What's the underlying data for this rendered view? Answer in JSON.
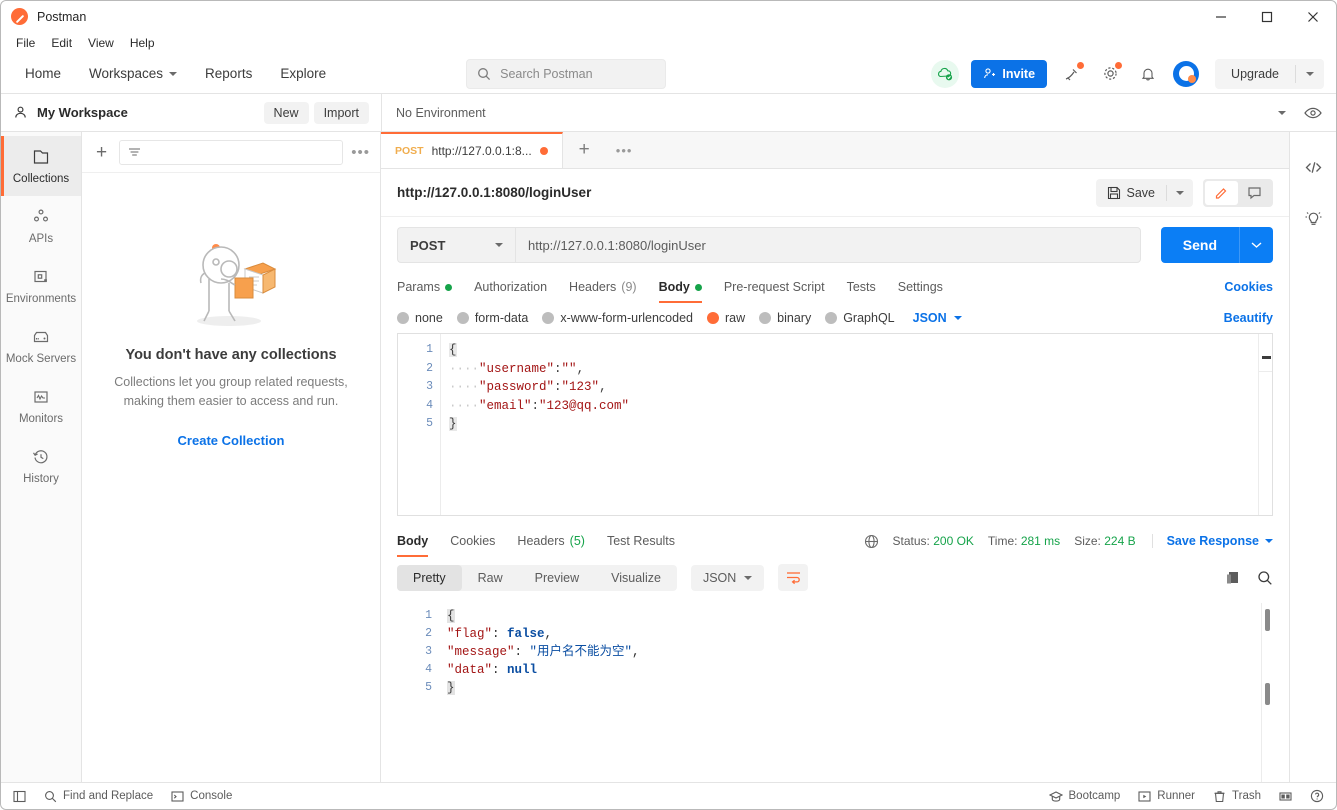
{
  "window": {
    "title": "Postman",
    "minimize": "—",
    "maximize": "□",
    "close": "✕"
  },
  "menubar": {
    "items": [
      "File",
      "Edit",
      "View",
      "Help"
    ]
  },
  "topnav": {
    "links": [
      {
        "label": "Home",
        "caret": false
      },
      {
        "label": "Workspaces",
        "caret": true
      },
      {
        "label": "Reports",
        "caret": false
      },
      {
        "label": "Explore",
        "caret": false
      }
    ],
    "search_placeholder": "Search Postman",
    "invite_label": "Invite",
    "upgrade_label": "Upgrade"
  },
  "workspace": {
    "name": "My Workspace",
    "new_label": "New",
    "import_label": "Import",
    "environment_value": "No Environment"
  },
  "rail": {
    "items": [
      {
        "label": "Collections",
        "icon": "collections-icon",
        "active": true
      },
      {
        "label": "APIs",
        "icon": "apis-icon",
        "active": false
      },
      {
        "label": "Environments",
        "icon": "environments-icon",
        "active": false
      },
      {
        "label": "Mock Servers",
        "icon": "mock-servers-icon",
        "active": false
      },
      {
        "label": "Monitors",
        "icon": "monitors-icon",
        "active": false
      },
      {
        "label": "History",
        "icon": "history-icon",
        "active": false
      }
    ]
  },
  "collections": {
    "filter_placeholder": "",
    "empty_title": "You don't have any collections",
    "empty_body": "Collections let you group related requests, making them easier to access and run.",
    "create_link": "Create Collection"
  },
  "request_tab": {
    "method": "POST",
    "title": "http://127.0.0.1:8...",
    "unsaved": true
  },
  "request": {
    "header_title": "http://127.0.0.1:8080/loginUser",
    "save_label": "Save",
    "method": "POST",
    "url": "http://127.0.0.1:8080/loginUser",
    "send_label": "Send",
    "tabs": [
      {
        "label": "Params",
        "dot": true,
        "count": "",
        "active": false
      },
      {
        "label": "Authorization",
        "dot": false,
        "count": "",
        "active": false
      },
      {
        "label": "Headers",
        "dot": false,
        "count": "(9)",
        "active": false
      },
      {
        "label": "Body",
        "dot": true,
        "count": "",
        "active": true
      },
      {
        "label": "Pre-request Script",
        "dot": false,
        "count": "",
        "active": false
      },
      {
        "label": "Tests",
        "dot": false,
        "count": "",
        "active": false
      },
      {
        "label": "Settings",
        "dot": false,
        "count": "",
        "active": false
      }
    ],
    "cookies_link": "Cookies",
    "body_types": [
      {
        "label": "none",
        "selected": false
      },
      {
        "label": "form-data",
        "selected": false
      },
      {
        "label": "x-www-form-urlencoded",
        "selected": false
      },
      {
        "label": "raw",
        "selected": true
      },
      {
        "label": "binary",
        "selected": false
      },
      {
        "label": "GraphQL",
        "selected": false
      }
    ],
    "body_format": "JSON",
    "beautify_label": "Beautify",
    "body_lines": [
      "1",
      "2",
      "3",
      "4",
      "5"
    ],
    "body_code": [
      {
        "indent": "",
        "brace": "{",
        "key": "",
        "sep": "",
        "value": "",
        "comma": ""
      },
      {
        "indent": "····",
        "brace": "",
        "key": "\"username\"",
        "sep": ":",
        "value": "\"\"",
        "comma": ","
      },
      {
        "indent": "····",
        "brace": "",
        "key": "\"password\"",
        "sep": ":",
        "value": "\"123\"",
        "comma": ","
      },
      {
        "indent": "····",
        "brace": "",
        "key": "\"email\"",
        "sep": ":",
        "value": "\"123@qq.com\"",
        "comma": ""
      },
      {
        "indent": "",
        "brace": "}",
        "key": "",
        "sep": "",
        "value": "",
        "comma": ""
      }
    ]
  },
  "response": {
    "tabs": [
      {
        "label": "Body",
        "count": "",
        "active": true
      },
      {
        "label": "Cookies",
        "count": "",
        "active": false
      },
      {
        "label": "Headers",
        "count": "(5)",
        "active": false
      },
      {
        "label": "Test Results",
        "count": "",
        "active": false
      }
    ],
    "status_label": "Status:",
    "status_value": "200 OK",
    "time_label": "Time:",
    "time_value": "281 ms",
    "size_label": "Size:",
    "size_value": "224 B",
    "save_response_label": "Save Response",
    "view_modes": [
      {
        "label": "Pretty",
        "active": true
      },
      {
        "label": "Raw",
        "active": false
      },
      {
        "label": "Preview",
        "active": false
      },
      {
        "label": "Visualize",
        "active": false
      }
    ],
    "format": "JSON",
    "lines": [
      "1",
      "2",
      "3",
      "4",
      "5"
    ],
    "code": [
      {
        "indent": "",
        "brace": "{",
        "key": "",
        "sep": "",
        "value": "",
        "vtype": "",
        "comma": ""
      },
      {
        "indent": "    ",
        "brace": "",
        "key": "\"flag\"",
        "sep": ": ",
        "value": "false",
        "vtype": "bool",
        "comma": ","
      },
      {
        "indent": "    ",
        "brace": "",
        "key": "\"message\"",
        "sep": ": ",
        "value": "\"用户名不能为空\"",
        "vtype": "str",
        "comma": ","
      },
      {
        "indent": "    ",
        "brace": "",
        "key": "\"data\"",
        "sep": ": ",
        "value": "null",
        "vtype": "bool",
        "comma": ""
      },
      {
        "indent": "",
        "brace": "}",
        "key": "",
        "sep": "",
        "value": "",
        "vtype": "",
        "comma": ""
      }
    ]
  },
  "statusbar": {
    "find_replace": "Find and Replace",
    "console": "Console",
    "bootcamp": "Bootcamp",
    "runner": "Runner",
    "trash": "Trash"
  },
  "colors": {
    "accent_orange": "#ff6c37",
    "link_blue": "#0b72e7",
    "send_blue": "#0b7ef5",
    "status_green": "#16a34a"
  }
}
